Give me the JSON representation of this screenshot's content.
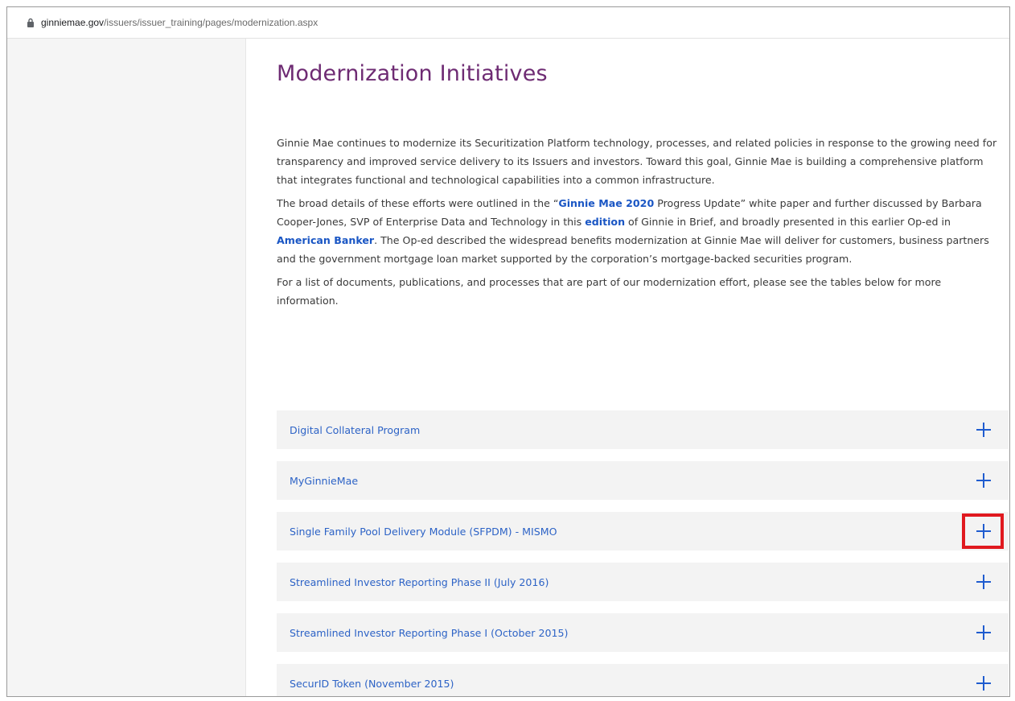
{
  "browser": {
    "url_host": "ginniemae.gov",
    "url_path": "/issuers/issuer_training/pages/modernization.aspx"
  },
  "page": {
    "title": "Modernization Initiatives",
    "para1": "Ginnie Mae continues to modernize its Securitization Platform technology, processes, and related policies in response to the growing need for transparency and improved service delivery to its Issuers and investors. Toward this goal, Ginnie Mae is building a comprehensive platform that integrates functional and technological capabilities into a common infrastructure.",
    "para2": {
      "t1": "The broad details of these efforts were outlined in the “",
      "link1": "Ginnie Mae 2020",
      "t2": " Progress Update” white paper and further discussed by Barbara Cooper-Jones, SVP of Enterprise Data and Technology in this ",
      "link2": "edition",
      "t3": " of Ginnie in Brief, and broadly presented in this earlier Op-ed in ",
      "link3": "American Banker",
      "t4": ". The Op-ed described the widespread benefits modernization at Ginnie Mae will deliver for customers, business partners and the government mortgage loan market supported by the corporation’s mortgage-backed securities program."
    },
    "para3": "For a list of documents, publications, and processes that are part of our modernization effort, please see the tables below for more information."
  },
  "accordion": {
    "items": [
      {
        "label": "Digital Collateral Program"
      },
      {
        "label": "MyGinnieMae"
      },
      {
        "label": "Single Family Pool Delivery Module (SFPDM) - MISMO"
      },
      {
        "label": "Streamlined Investor Reporting Phase II (July 2016)"
      },
      {
        "label": "Streamlined Investor Reporting Phase I (October 2015)"
      },
      {
        "label": "SecurID Token (November 2015)"
      }
    ],
    "highlighted_index": 2
  },
  "colors": {
    "title": "#6e2b73",
    "link": "#1a56c4",
    "accordion_text": "#2d63c6",
    "plus": "#1f5ccf",
    "highlight": "#e0191f"
  }
}
